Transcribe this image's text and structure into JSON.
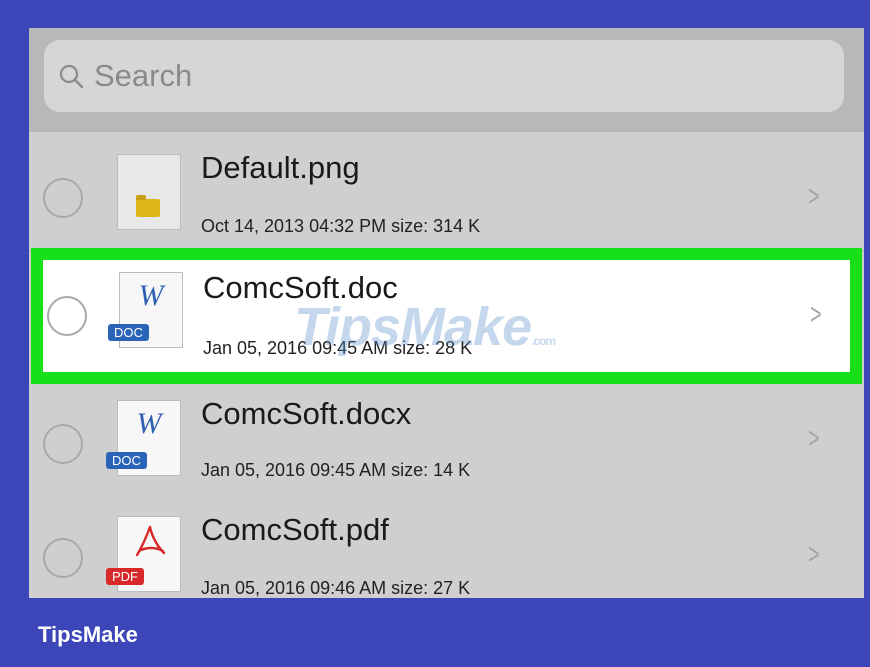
{
  "search": {
    "placeholder": "Search"
  },
  "files": [
    {
      "name": "Default.png",
      "meta": "Oct 14, 2013 04:32 PM  size: 314 K",
      "icon": "image-thumbnail-icon"
    },
    {
      "name": "ComcSoft.doc",
      "meta": "Jan 05, 2016 09:45 AM  size: 28 K",
      "icon": "word-doc-icon",
      "badge": "DOC",
      "selected": true
    },
    {
      "name": "ComcSoft.docx",
      "meta": "Jan 05, 2016 09:45 AM  size: 14 K",
      "icon": "word-doc-icon",
      "badge": "DOC"
    },
    {
      "name": "ComcSoft.pdf",
      "meta": "Jan 05, 2016 09:46 AM  size: 27 K",
      "icon": "pdf-icon",
      "badge": "PDF"
    }
  ],
  "icon_letters": {
    "word": "W"
  },
  "watermark": {
    "text": "TipsMake",
    "suffix": ".com"
  },
  "brand": "TipsMake",
  "colors": {
    "background": "#3c46b9",
    "highlight": "#18e018",
    "doc_badge": "#2a64b8",
    "pdf_badge": "#d8282a"
  }
}
